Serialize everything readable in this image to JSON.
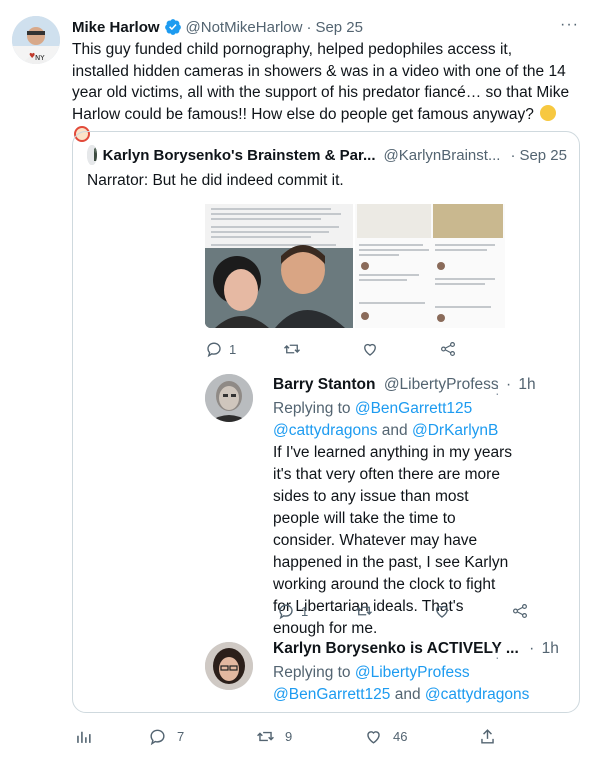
{
  "tweet": {
    "author_name": "Mike Harlow",
    "handle": "@NotMikeHarlow",
    "separator": "·",
    "date": "Sep 25",
    "more": "···",
    "text": "This guy funded child pornography, helped pedophiles access it, installed hidden cameras in showers & was in a video with one of the 14 year old victims, all with the support of his predator fiancé… so that Mike Harlow could be famous!! How else do people get famous anyway?",
    "emojis": [
      "laughing-emoji",
      "clown-emoji"
    ]
  },
  "quote": {
    "author_name": "Karlyn Borysenko's Brainstem & Par...",
    "handle": "@KarlynBrainst...",
    "separator": "·",
    "date": "Sep 25",
    "text": "Narrator: But he did indeed commit it.",
    "first_actions": {
      "reply_count": "1"
    },
    "reply1": {
      "name": "Barry Stanton",
      "handle": "@LibertyProfess",
      "separator": "·",
      "time": "1h",
      "replying_prefix": "Replying to",
      "mentions_line1": "@BenGarrett125",
      "mentions_line2a": "@cattydragons",
      "and_word": "and",
      "mentions_line2b": "@DrKarlynB",
      "body": "If I've learned anything in my years it's that very often there are more sides to any issue than most people will take the time to consider. Whatever may have happened in the past, I see Karlyn working around the clock to fight for Libertarian ideals. That's enough for me.",
      "reply_count": "1"
    },
    "reply2": {
      "name": "Karlyn Borysenko is ACTIVELY ...",
      "separator": "·",
      "time": "1h",
      "replying_prefix": "Replying to",
      "mentions_line1": "@LibertyProfess",
      "mentions_line2a": "@BenGarrett125",
      "and_word": "and",
      "mentions_line2b": "@cattydragons"
    }
  },
  "bottom_actions": {
    "reply_count": "7",
    "retweet_count": "9",
    "like_count": "46"
  },
  "colors": {
    "accent": "#1d9bf0",
    "muted": "#536471",
    "border": "#cfd9de"
  }
}
